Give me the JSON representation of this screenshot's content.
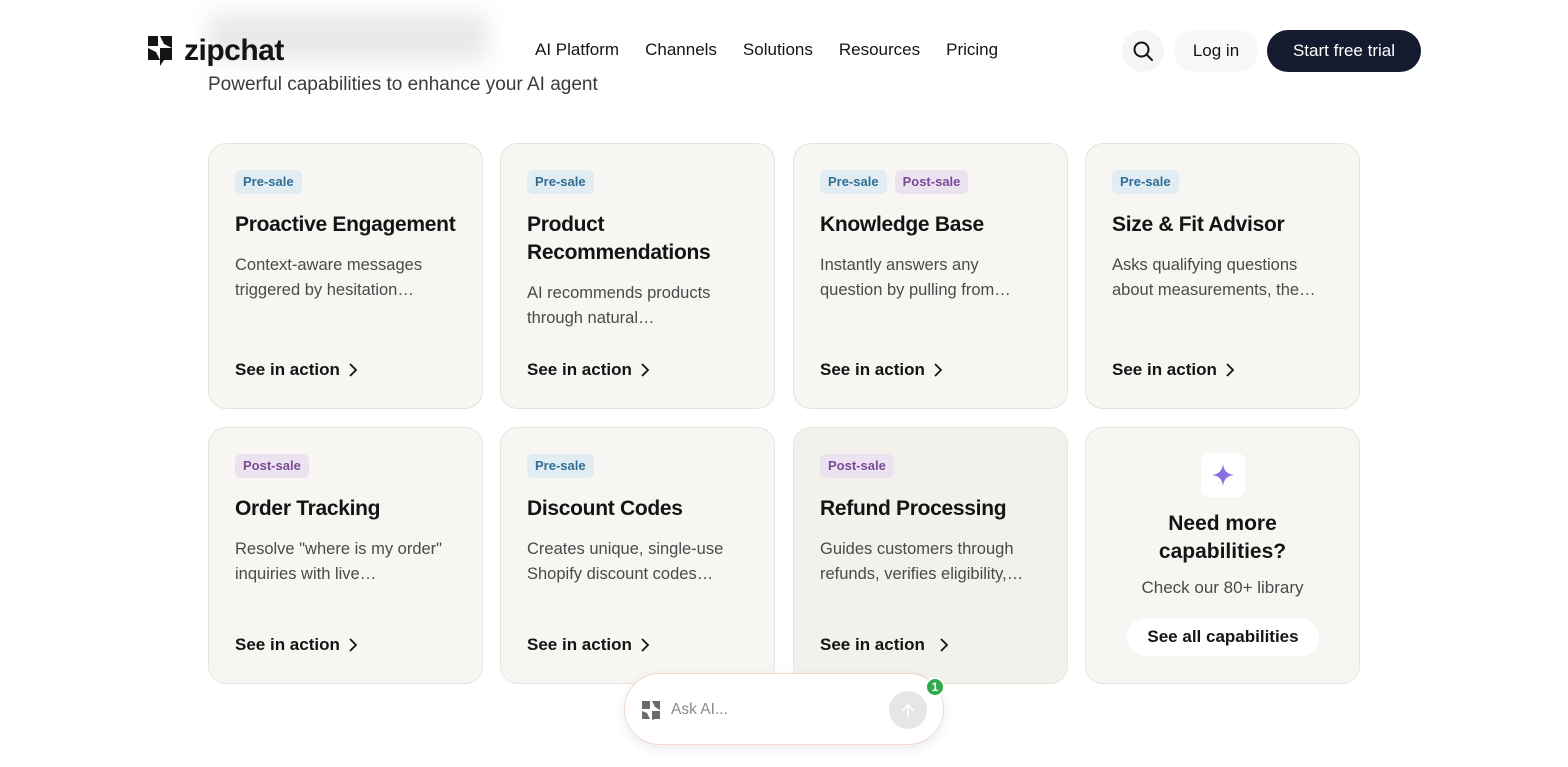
{
  "header": {
    "subtitle": "Powerful capabilities to enhance your AI agent",
    "logo_text": "zipchat",
    "nav": [
      "AI Platform",
      "Channels",
      "Solutions",
      "Resources",
      "Pricing"
    ],
    "login_label": "Log in",
    "trial_label": "Start free trial"
  },
  "cards": [
    {
      "tags": [
        {
          "label": "Pre-sale",
          "kind": "pre"
        }
      ],
      "title": "Proactive Engagement",
      "desc": "Context-aware messages triggered by hesitation…",
      "cta": "See in action"
    },
    {
      "tags": [
        {
          "label": "Pre-sale",
          "kind": "pre"
        }
      ],
      "title": "Product Recommendations",
      "desc": "AI recommends products through natural…",
      "cta": "See in action"
    },
    {
      "tags": [
        {
          "label": "Pre-sale",
          "kind": "pre"
        },
        {
          "label": "Post-sale",
          "kind": "post"
        }
      ],
      "title": "Knowledge Base",
      "desc": "Instantly answers any question by pulling from…",
      "cta": "See in action"
    },
    {
      "tags": [
        {
          "label": "Pre-sale",
          "kind": "pre"
        }
      ],
      "title": "Size & Fit Advisor",
      "desc": "Asks qualifying questions about measurements, the…",
      "cta": "See in action"
    },
    {
      "tags": [
        {
          "label": "Post-sale",
          "kind": "post"
        }
      ],
      "title": "Order Tracking",
      "desc": "Resolve \"where is my order\" inquiries with live…",
      "cta": "See in action"
    },
    {
      "tags": [
        {
          "label": "Pre-sale",
          "kind": "pre"
        }
      ],
      "title": "Discount Codes",
      "desc": "Creates unique, single-use Shopify discount codes…",
      "cta": "See in action"
    },
    {
      "tags": [
        {
          "label": "Post-sale",
          "kind": "post"
        }
      ],
      "title": "Refund Processing",
      "desc": "Guides customers through refunds, verifies eligibility,…",
      "cta": "See in action"
    }
  ],
  "more": {
    "title": "Need more capabilities?",
    "subtitle": "Check our 80+ library",
    "button": "See all capabilities"
  },
  "ask": {
    "placeholder": "Ask AI...",
    "badge": "1"
  },
  "colors": {
    "accent_dark": "#141b2e",
    "pre_sale": "#2f6f95",
    "post_sale": "#7a4a98",
    "sparkle": "#8b6fe0",
    "badge_green": "#2faa4a"
  }
}
